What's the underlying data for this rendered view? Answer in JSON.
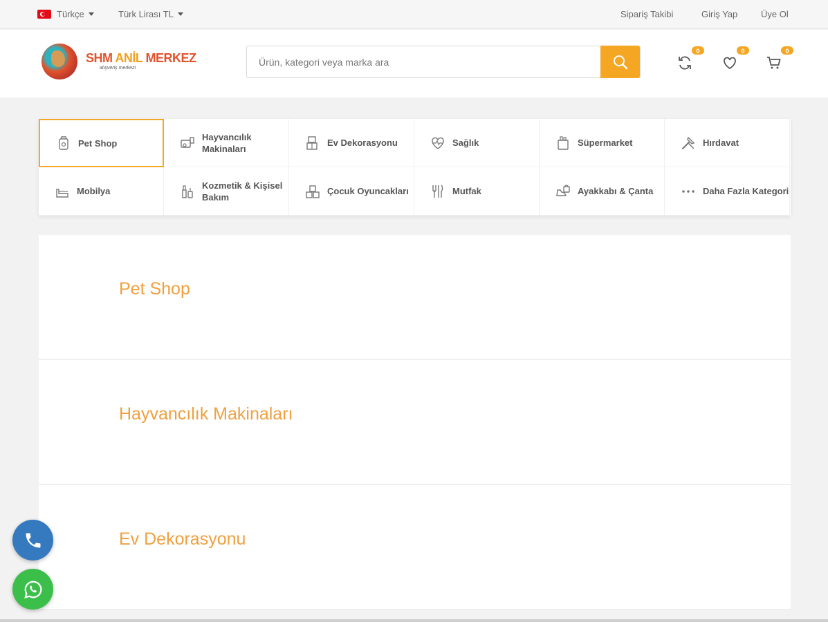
{
  "topbar": {
    "language": "Türkçe",
    "currency": "Türk Lirası TL",
    "links": [
      "Sipariş Takibi",
      "Giriş Yap",
      "Üye Ol"
    ]
  },
  "header": {
    "brand_first": "SHM",
    "brand_middle": "ANİL",
    "brand_last": "MERKEZ",
    "brand_tagline": "alışveriş merkezi",
    "search_placeholder": "Ürün, kategori veya marka ara",
    "counters": {
      "compare": "0",
      "wishlist": "0",
      "cart": "0"
    }
  },
  "categories": [
    {
      "label": "Pet Shop",
      "icon": "pet-food-icon"
    },
    {
      "label": "Hayvancılık Makinaları",
      "icon": "machine-icon"
    },
    {
      "label": "Ev Dekorasyonu",
      "icon": "home-decor-icon"
    },
    {
      "label": "Sağlık",
      "icon": "heart-pulse-icon"
    },
    {
      "label": "Süpermarket",
      "icon": "grocery-icon"
    },
    {
      "label": "Hırdavat",
      "icon": "tools-icon"
    },
    {
      "label": "Mobilya",
      "icon": "sofa-icon"
    },
    {
      "label": "Kozmetik & Kişisel Bakım",
      "icon": "cosmetics-icon"
    },
    {
      "label": "Çocuk Oyuncakları",
      "icon": "toy-blocks-icon"
    },
    {
      "label": "Mutfak",
      "icon": "kitchen-utensils-icon"
    },
    {
      "label": "Ayakkabı & Çanta",
      "icon": "shoe-bag-icon"
    },
    {
      "label": "Daha Fazla Kategori",
      "icon": "more-dots-icon"
    }
  ],
  "sections": [
    "Pet Shop",
    "Hayvancılık Makinaları",
    "Ev Dekorasyonu"
  ],
  "colors": {
    "accent": "#f5a623",
    "section_title": "#f0a040",
    "phone": "#3579bf",
    "whatsapp": "#3cbf4a"
  }
}
